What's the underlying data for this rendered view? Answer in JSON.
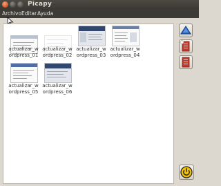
{
  "window": {
    "title": "Picapy"
  },
  "menubar": {
    "items": [
      "Archivo",
      "Editar",
      "Ayuda"
    ]
  },
  "gallery": {
    "items": [
      {
        "line1": "actualizar_w",
        "line2": "ordpress_01"
      },
      {
        "line1": "actualizar_w",
        "line2": "ordpress_02"
      },
      {
        "line1": "actualizar_w",
        "line2": "ordpress_03"
      },
      {
        "line1": "actualizar_w",
        "line2": "ordpress_04"
      },
      {
        "line1": "actualizar_w",
        "line2": "ordpress_05"
      },
      {
        "line1": "actualizar_w",
        "line2": "ordpress_06"
      }
    ]
  },
  "sidebar": {
    "buttons": [
      {
        "icon": "upload-icon"
      },
      {
        "icon": "document-red-icon"
      },
      {
        "icon": "document-list-icon"
      },
      {
        "icon": "power-icon"
      }
    ]
  },
  "colors": {
    "titlebar": "#3a3833",
    "accent_blue": "#2a66c4",
    "document_red": "#c0392b",
    "power_yellow": "#f2c200"
  }
}
